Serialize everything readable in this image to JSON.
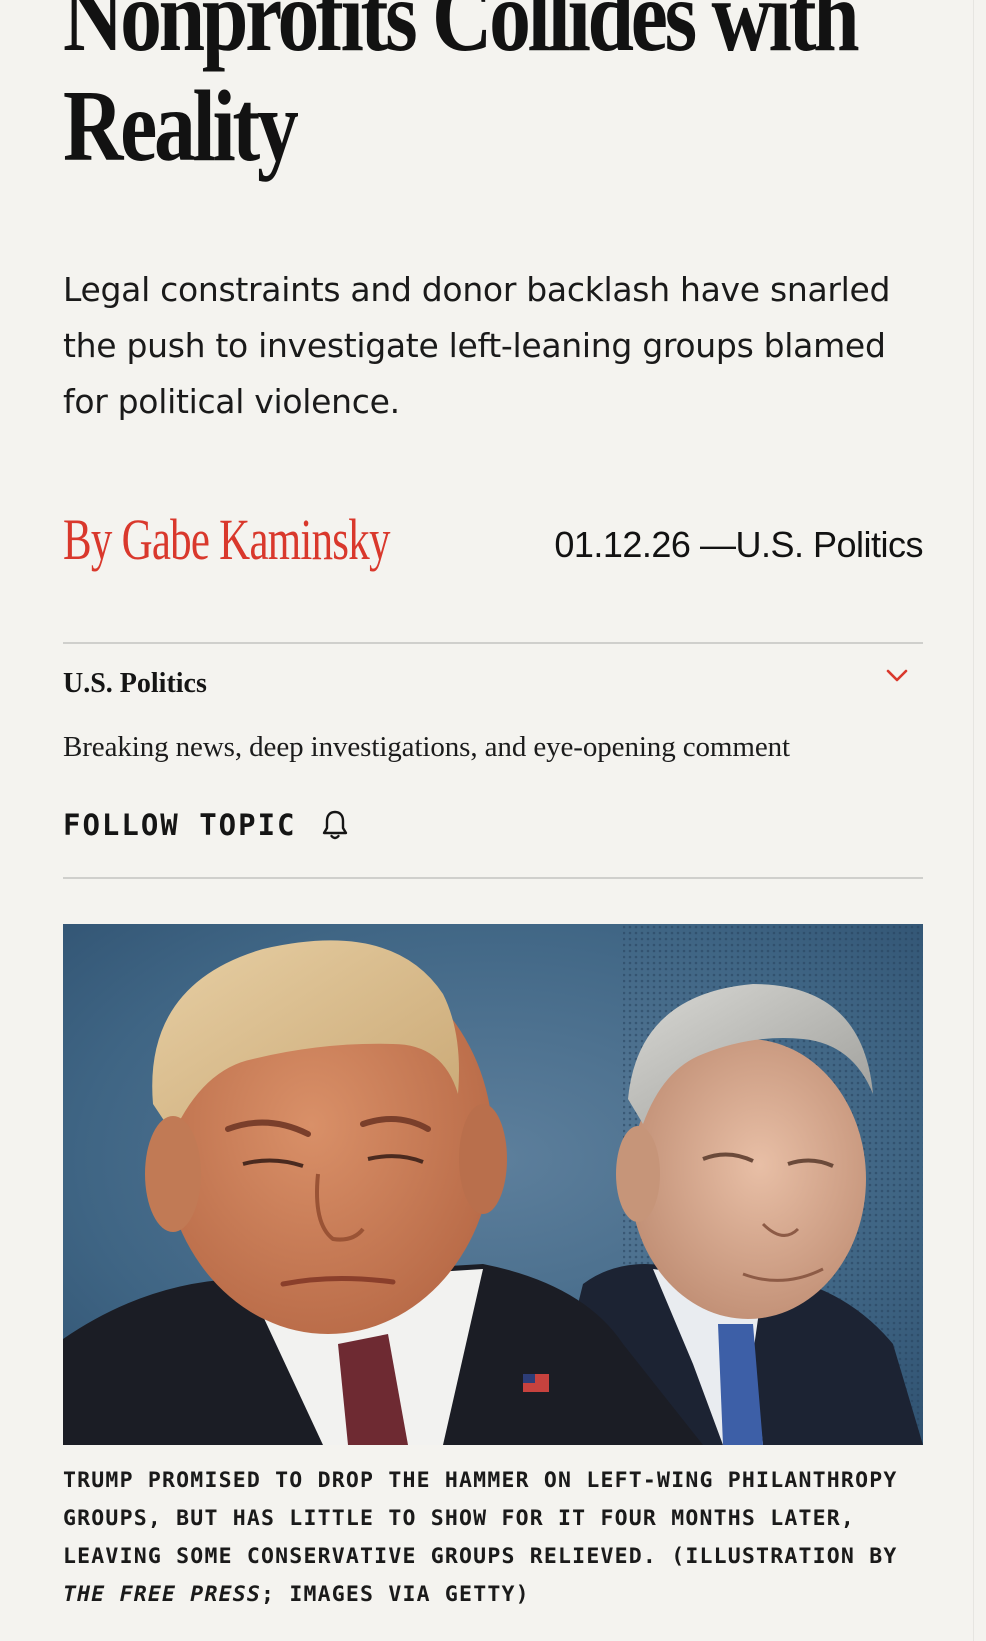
{
  "article": {
    "headline_line1": "Nonprofits Collides with",
    "headline_line2": "Reality",
    "dek_line1": "Legal constraints and donor backlash have snarled",
    "dek_line2": "the push to investigate left-leaning groups blamed",
    "dek_line3": "for political violence.",
    "byline": "By Gabe Kaminsky",
    "dateline": "01.12.26 —U.S. Politics"
  },
  "topic": {
    "title": "U.S. Politics",
    "description": "Breaking news, deep investigations, and eye-opening comment",
    "follow_label": "FOLLOW TOPIC",
    "follow_icon": "bell-icon",
    "expand_icon": "chevron-down-icon"
  },
  "hero_image": {
    "caption_part1": "Trump promised to drop the hammer on left-wing philanthropy groups, but has little to show for it four months later, leaving some conservative groups relieved. (Illustration by ",
    "caption_italic": "The Free Press",
    "caption_part2": "; images via Getty)"
  },
  "colors": {
    "accent": "#d9382c",
    "background": "#f4f3ef",
    "text": "#121212",
    "divider": "#cfcfcc"
  }
}
